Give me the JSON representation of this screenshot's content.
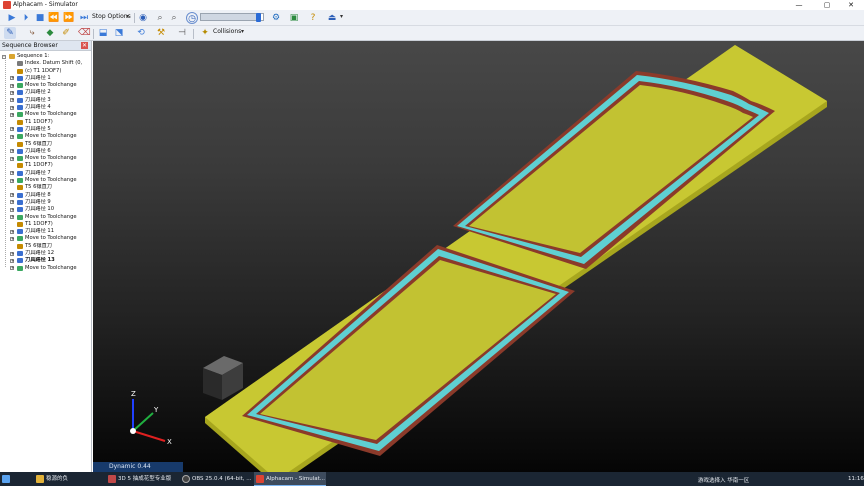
{
  "window": {
    "title": "Alphacam - Simulator",
    "minimize": "—",
    "maximize": "▢",
    "close": "✕"
  },
  "toolbar1": {
    "stop_options_label": "Stop Options",
    "progress_fraction": 0.92
  },
  "toolbar2": {
    "collisions_label": "Collisions"
  },
  "sequence_browser": {
    "title": "Sequence Browser",
    "close": "✕",
    "items": [
      {
        "label": "Sequence 1:",
        "level": 0,
        "icon": "sequence-icon",
        "expander": "-"
      },
      {
        "label": "Index. Datum Shift (0,",
        "level": 1,
        "icon": "datum-icon",
        "expander": ""
      },
      {
        "label": "(c) T1 1DOF7)",
        "level": 1,
        "icon": "tool-icon",
        "expander": ""
      },
      {
        "label": "刀具路径 1",
        "level": 1,
        "icon": "toolpath-icon",
        "expander": "+"
      },
      {
        "label": "Move to Toolchange",
        "level": 1,
        "icon": "move-icon",
        "expander": "+"
      },
      {
        "label": "刀具路径 2",
        "level": 1,
        "icon": "toolpath-icon",
        "expander": "+"
      },
      {
        "label": "刀具路径 3",
        "level": 1,
        "icon": "toolpath-icon",
        "expander": "+"
      },
      {
        "label": "刀具路径 4",
        "level": 1,
        "icon": "toolpath-icon",
        "expander": "+"
      },
      {
        "label": "Move to Toolchange",
        "level": 1,
        "icon": "move-icon",
        "expander": "+"
      },
      {
        "label": "T1 1DOF7)",
        "level": 1,
        "icon": "tool-icon",
        "expander": ""
      },
      {
        "label": "刀具路径 5",
        "level": 1,
        "icon": "toolpath-icon",
        "expander": "+"
      },
      {
        "label": "Move to Toolchange",
        "level": 1,
        "icon": "move-icon",
        "expander": "+"
      },
      {
        "label": "T5 6镶直刀",
        "level": 1,
        "icon": "tool-icon",
        "expander": ""
      },
      {
        "label": "刀具路径 6",
        "level": 1,
        "icon": "toolpath-icon",
        "expander": "+"
      },
      {
        "label": "Move to Toolchange",
        "level": 1,
        "icon": "move-icon",
        "expander": "+"
      },
      {
        "label": "T1 1DOF7)",
        "level": 1,
        "icon": "tool-icon",
        "expander": ""
      },
      {
        "label": "刀具路径 7",
        "level": 1,
        "icon": "toolpath-icon",
        "expander": "+"
      },
      {
        "label": "Move to Toolchange",
        "level": 1,
        "icon": "move-icon",
        "expander": "+"
      },
      {
        "label": "T5 6镶直刀",
        "level": 1,
        "icon": "tool-icon",
        "expander": ""
      },
      {
        "label": "刀具路径 8",
        "level": 1,
        "icon": "toolpath-icon",
        "expander": "+"
      },
      {
        "label": "刀具路径 9",
        "level": 1,
        "icon": "toolpath-icon",
        "expander": "+"
      },
      {
        "label": "刀具路径 10",
        "level": 1,
        "icon": "toolpath-icon",
        "expander": "+"
      },
      {
        "label": "Move to Toolchange",
        "level": 1,
        "icon": "move-icon",
        "expander": "+"
      },
      {
        "label": "T1 1DOF7)",
        "level": 1,
        "icon": "tool-icon",
        "expander": ""
      },
      {
        "label": "刀具路径 11",
        "level": 1,
        "icon": "toolpath-icon",
        "expander": "+"
      },
      {
        "label": "Move to Toolchange",
        "level": 1,
        "icon": "move-icon",
        "expander": "+"
      },
      {
        "label": "T5 6镶直刀",
        "level": 1,
        "icon": "tool-icon",
        "expander": ""
      },
      {
        "label": "刀具路径 12",
        "level": 1,
        "icon": "toolpath-icon",
        "expander": "+"
      },
      {
        "label": "刀具路径 13",
        "level": 1,
        "icon": "toolpath-icon",
        "expander": "+",
        "bold": true
      },
      {
        "label": "Move to Toolchange",
        "level": 1,
        "icon": "move-icon",
        "expander": "+"
      }
    ]
  },
  "viewport": {
    "axis_x": "X",
    "axis_y": "Y",
    "axis_z": "Z",
    "colors": {
      "door": "#c8c832",
      "door_side": "#a7a61e",
      "groove": "#5fd0d2",
      "groove_edge": "#8b3a2a"
    }
  },
  "status_bar": {
    "text": "Dynamic 0.44"
  },
  "taskbar": {
    "items": [
      {
        "label": "",
        "icon": "windows-start-icon",
        "active": false
      },
      {
        "label": "稳源的负",
        "icon": "app-icon",
        "active": false
      },
      {
        "label": "3D 5 抽成花型专业版",
        "icon": "app-icon",
        "active": false
      },
      {
        "label": "OBS 25.0.4 (64-bit, ...",
        "icon": "obs-icon",
        "active": false
      },
      {
        "label": "Alphacam - Simulat...",
        "icon": "alphacam-icon",
        "active": true
      }
    ],
    "tray_text": "游戏选择入 华南一区",
    "clock": "11:16"
  }
}
